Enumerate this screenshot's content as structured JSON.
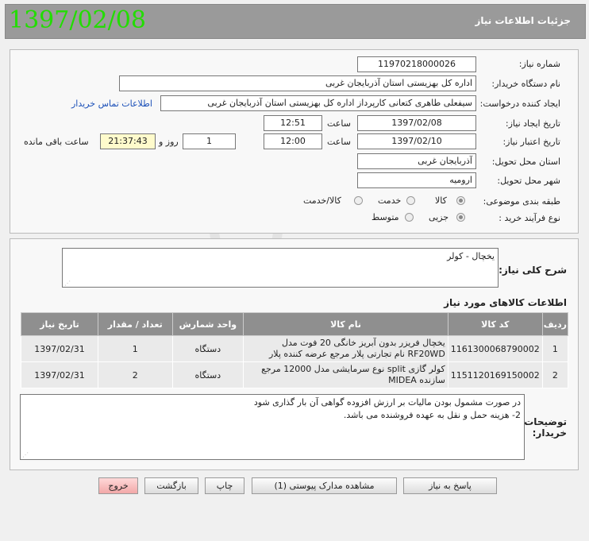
{
  "header": {
    "title": "جزئیات اطلاعات نیاز",
    "date_stamp": "1397/02/08"
  },
  "form": {
    "need_number_label": "شماره نیاز:",
    "need_number": "11970218000026",
    "buyer_org_label": "نام دستگاه خریدار:",
    "buyer_org": "اداره کل بهزیستی استان آذربایجان غربی",
    "requester_label": "ایجاد کننده درخواست:",
    "requester": "سیفعلی طاهری کتعانی کارپرداز اداره کل بهزیستی استان آذربایجان غربی",
    "contact_link": "اطلاعات تماس خریدار",
    "created_label": "تاریخ ایجاد نیاز:",
    "created_date": "1397/02/08",
    "time_label": "ساعت",
    "created_time": "12:51",
    "validity_label": "تاریخ اعتبار نیاز:",
    "validity_date": "1397/02/10",
    "validity_time": "12:00",
    "days": "1",
    "days_suffix": "روز و",
    "remaining": "21:37:43",
    "remaining_suffix": "ساعت باقی مانده",
    "province_label": "استان محل تحویل:",
    "province": "آذربایجان غربی",
    "city_label": "شهر محل تحویل:",
    "city": "ارومیه",
    "category_label": "طبقه بندی موضوعی:",
    "category_options": [
      "کالا",
      "خدمت",
      "کالا/خدمت"
    ],
    "category_selected": "کالا",
    "process_label": "نوع فرآیند خرید :",
    "process_options": [
      "جزیی",
      "متوسط"
    ],
    "process_selected": "جزیی"
  },
  "summary": {
    "label": "شرح کلی نیاز:",
    "text": "یخچال - کولر"
  },
  "goods": {
    "section_title": "اطلاعات کالاهای مورد نیاز",
    "columns": [
      "ردیف",
      "کد کالا",
      "نام کالا",
      "واحد شمارش",
      "تعداد / مقدار",
      "تاریخ نیاز"
    ],
    "rows": [
      {
        "row": "1",
        "code": "1161300068790002",
        "name": "یخچال فریزر بدون آبریز خانگی 20 فوت مدل RF20WD نام تجارتی پلار مرجع عرضه کننده پلار",
        "unit": "دستگاه",
        "qty": "1",
        "date": "1397/02/31"
      },
      {
        "row": "2",
        "code": "1151120169150002",
        "name": "کولر گازی split نوع سرمایشی مدل 12000 مرجع سازنده MIDEA",
        "unit": "دستگاه",
        "qty": "2",
        "date": "1397/02/31"
      }
    ]
  },
  "notes": {
    "label": "توضیحات خریدار:",
    "line1": "در صورت مشمول بودن مالیات بر ارزش افزوده گواهی آن بار گذاری شود",
    "line2": "2- هزینه حمل و نقل به عهده فروشنده می باشد."
  },
  "buttons": {
    "reply": "پاسخ به نیاز",
    "attachments": "مشاهده مدارک پیوستی (1)",
    "print": "چاپ",
    "back": "بازگشت",
    "exit": "خروج"
  },
  "colors": {
    "date_stamp": "#22dd00",
    "title_bar": "#9a9a9a",
    "table_header": "#8f8f8f",
    "link": "#1a4fb8",
    "remaining_bg": "#fffbcc"
  }
}
